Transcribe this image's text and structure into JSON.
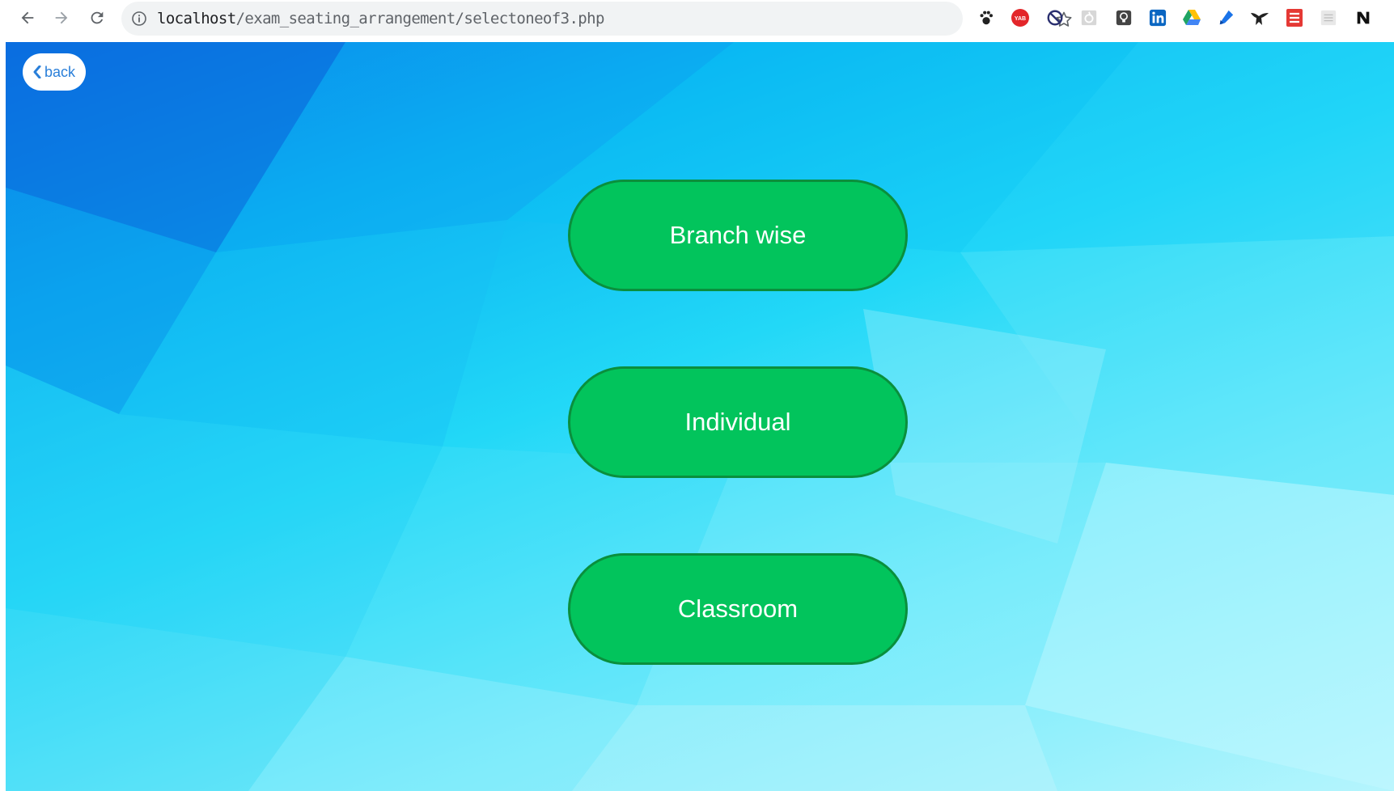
{
  "browser": {
    "url_host": "localhost",
    "url_path": "/exam_seating_arrangement/selectoneof3.php",
    "nav_icons": [
      "back-arrow-icon",
      "forward-arrow-icon",
      "reload-icon"
    ],
    "extension_icons": [
      "paw-icon",
      "yab-icon",
      "block-icon",
      "pocket-icon",
      "lightbulb-icon",
      "linkedin-icon",
      "google-drive-icon",
      "pen-icon",
      "eagle-icon",
      "stack-icon",
      "grid-icon",
      "notion-icon"
    ]
  },
  "page": {
    "back_label": "back",
    "options": [
      {
        "label": "Branch wise"
      },
      {
        "label": "Individual"
      },
      {
        "label": "Classroom"
      }
    ]
  },
  "colors": {
    "button_green": "#02c45c",
    "button_border": "#0a8f3c",
    "back_text": "#2a7fd9",
    "background_top": "#0a7fe8",
    "background_bottom": "#b5f5fd"
  }
}
